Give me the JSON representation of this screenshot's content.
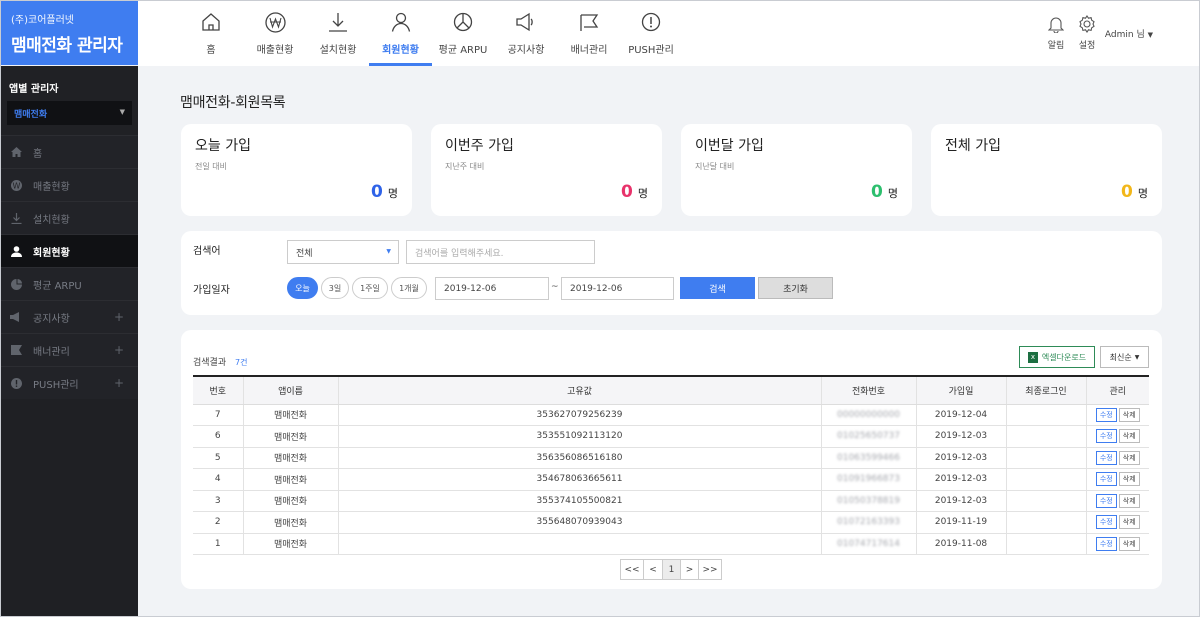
{
  "brand": {
    "company": "(주)코어플러넷",
    "title": "맴매전화 관리자"
  },
  "sidebar": {
    "title": "앱별 관리자",
    "app_select": "맴매전화",
    "items": [
      {
        "label": "홈",
        "icon": "home-icon"
      },
      {
        "label": "매출현황",
        "icon": "won-icon"
      },
      {
        "label": "설치현황",
        "icon": "download-icon"
      },
      {
        "label": "회원현황",
        "icon": "user-icon"
      },
      {
        "label": "평균 ARPU",
        "icon": "pie-icon"
      },
      {
        "label": "공지사항",
        "icon": "megaphone-icon"
      },
      {
        "label": "배너관리",
        "icon": "flag-icon"
      },
      {
        "label": "PUSH관리",
        "icon": "alert-icon"
      }
    ]
  },
  "topnav": {
    "items": [
      {
        "label": "홈"
      },
      {
        "label": "매출현황"
      },
      {
        "label": "설치현황"
      },
      {
        "label": "회원현황"
      },
      {
        "label": "평균 ARPU"
      },
      {
        "label": "공지사항"
      },
      {
        "label": "배너관리"
      },
      {
        "label": "PUSH관리"
      }
    ],
    "alarm": "알림",
    "settings": "설정",
    "admin": "Admin 님"
  },
  "page_title": "맴매전화-회원목록",
  "stats": [
    {
      "title": "오늘 가입",
      "sub": "전일 대비",
      "value": "0",
      "unit": "명",
      "color": "#2f63e8"
    },
    {
      "title": "이번주 가입",
      "sub": "지난주 대비",
      "value": "0",
      "unit": "명",
      "color": "#e8336b"
    },
    {
      "title": "이번달 가입",
      "sub": "지난달 대비",
      "value": "0",
      "unit": "명",
      "color": "#2dbf6e"
    },
    {
      "title": "전체 가입",
      "sub": "",
      "value": "0",
      "unit": "명",
      "color": "#f2b71a"
    }
  ],
  "search": {
    "keyword_label": "검색어",
    "scope": "전체",
    "keyword_placeholder": "검색어를 입력해주세요.",
    "date_label": "가입일자",
    "periods": [
      "오늘",
      "3일",
      "1주일",
      "1개월"
    ],
    "date_from": "2019-12-06",
    "tilde": "~",
    "date_to": "2019-12-06",
    "search_btn": "검색",
    "reset_btn": "초기화"
  },
  "results": {
    "label": "검색결과",
    "count": "7건",
    "excel_btn": "엑셀다운로드",
    "sort": "최신순",
    "columns": [
      "번호",
      "앱이름",
      "고유값",
      "전화번호",
      "가입일",
      "최종로그인",
      "관리"
    ],
    "rows": [
      {
        "no": "7",
        "app": "맴매전화",
        "id": "353627079256239",
        "phone": "00000000000",
        "joined": "2019-12-04",
        "last": ""
      },
      {
        "no": "6",
        "app": "맴매전화",
        "id": "353551092113120",
        "phone": "01025650737",
        "joined": "2019-12-03",
        "last": ""
      },
      {
        "no": "5",
        "app": "맴매전화",
        "id": "356356086516180",
        "phone": "01063599466",
        "joined": "2019-12-03",
        "last": ""
      },
      {
        "no": "4",
        "app": "맴매전화",
        "id": "354678063665611",
        "phone": "01091966873",
        "joined": "2019-12-03",
        "last": ""
      },
      {
        "no": "3",
        "app": "맴매전화",
        "id": "355374105500821",
        "phone": "01050378819",
        "joined": "2019-12-03",
        "last": ""
      },
      {
        "no": "2",
        "app": "맴매전화",
        "id": "355648070939043",
        "phone": "01072163393",
        "joined": "2019-11-19",
        "last": ""
      },
      {
        "no": "1",
        "app": "맴매전화",
        "id": "",
        "phone": "01074717614",
        "joined": "2019-11-08",
        "last": ""
      }
    ],
    "edit": "수정",
    "delete": "삭제"
  },
  "pager": {
    "first": "<<",
    "prev": "<",
    "page": "1",
    "next": ">",
    "last": ">>"
  }
}
